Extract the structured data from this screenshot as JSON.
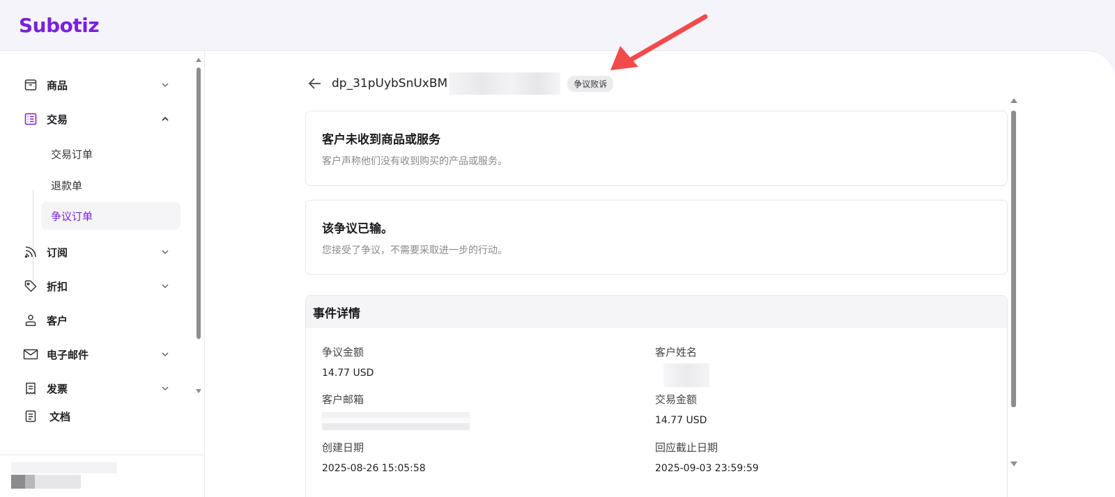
{
  "app": {
    "logo": "Subotiz"
  },
  "sidebar": {
    "items": [
      {
        "label": "商品",
        "icon": "box-icon"
      },
      {
        "label": "交易",
        "icon": "list-icon"
      },
      {
        "label": "订阅",
        "icon": "rss-icon"
      },
      {
        "label": "折扣",
        "icon": "tag-icon"
      },
      {
        "label": "客户",
        "icon": "user-icon"
      },
      {
        "label": "电子邮件",
        "icon": "mail-icon"
      },
      {
        "label": "发票",
        "icon": "invoice-icon"
      },
      {
        "label": "文档",
        "icon": "doc-icon"
      }
    ],
    "sub_items": [
      {
        "label": "交易订单"
      },
      {
        "label": "退款单"
      },
      {
        "label": "争议订单"
      }
    ]
  },
  "header": {
    "dispute_id": "dp_31pUybSnUxBM",
    "status_badge": "争议败诉"
  },
  "reason_card": {
    "title": "客户未收到商品或服务",
    "description": "客户声称他们没有收到购买的产品或服务。"
  },
  "result_card": {
    "title": "该争议已输。",
    "description": "您接受了争议，不需要采取进一步的行动。"
  },
  "events": {
    "title": "事件详情",
    "fields": {
      "dispute_amount": {
        "label": "争议金额",
        "value": "14.77 USD"
      },
      "customer_name": {
        "label": "客户姓名",
        "value": ""
      },
      "customer_email": {
        "label": "客户邮箱",
        "value": ""
      },
      "transaction_amount": {
        "label": "交易金额",
        "value": "14.77 USD"
      },
      "created_date": {
        "label": "创建日期",
        "value": "2025-08-26 15:05:58"
      },
      "response_deadline": {
        "label": "回应截止日期",
        "value": "2025-09-03 23:59:59"
      }
    }
  },
  "colors": {
    "brand": "#7c1fe0",
    "annotation_arrow": "#f24b4b"
  }
}
